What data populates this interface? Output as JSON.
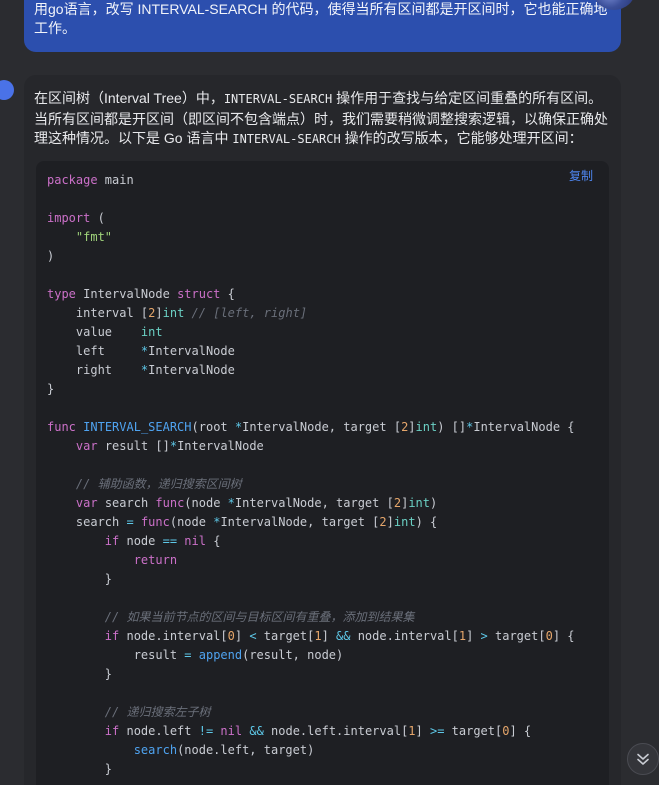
{
  "user_message": {
    "text": "用go语言，改写 INTERVAL-SEARCH 的代码，使得当所有区间都是开区间时，它也能正确地工作。"
  },
  "assistant": {
    "intro_parts": [
      "在区间树（Interval Tree）中，",
      "INTERVAL-SEARCH",
      " 操作用于查找与给定区间重叠的所有区间。当所有区间都是开区间（即区间不包含端点）时，我们需要稍微调整搜索逻辑，以确保正确处理这种情况。以下是 Go 语言中 ",
      "INTERVAL-SEARCH",
      " 操作的改写版本，它能够处理开区间："
    ],
    "copy_label": "复制"
  },
  "code": {
    "language": "go",
    "lines": [
      "package main",
      "",
      "import (",
      "    \"fmt\"",
      ")",
      "",
      "type IntervalNode struct {",
      "    interval [2]int // [left, right]",
      "    value    int",
      "    left     *IntervalNode",
      "    right    *IntervalNode",
      "}",
      "",
      "func INTERVAL_SEARCH(root *IntervalNode, target [2]int) []*IntervalNode {",
      "    var result []*IntervalNode",
      "",
      "    // 辅助函数，递归搜索区间树",
      "    var search func(node *IntervalNode, target [2]int)",
      "    search = func(node *IntervalNode, target [2]int) {",
      "        if node == nil {",
      "            return",
      "        }",
      "",
      "        // 如果当前节点的区间与目标区间有重叠，添加到结果集",
      "        if node.interval[0] < target[1] && node.interval[1] > target[0] {",
      "            result = append(result, node)",
      "        }",
      "",
      "        // 递归搜索左子树",
      "        if node.left != nil && node.left.interval[1] >= target[0] {",
      "            search(node.left, target)",
      "        }"
    ]
  },
  "icons": {
    "scroll_down": "double-chevron-down-icon"
  },
  "colors": {
    "user_bubble": "#2c4fae",
    "background": "#2b2c30",
    "code_bg": "#1e1f23",
    "accent": "#4e86f0"
  }
}
